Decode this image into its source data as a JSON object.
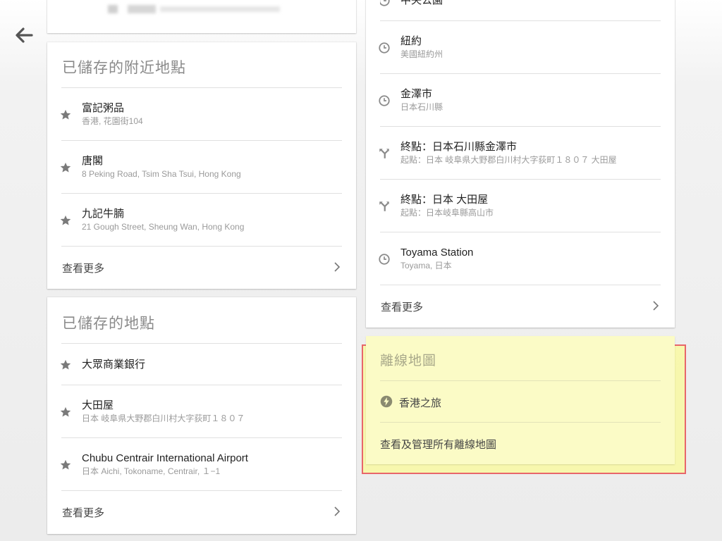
{
  "nav": {
    "back_icon": "arrow-left-icon"
  },
  "colors": {
    "highlight_border": "#e8666a",
    "highlight_fill": "#ffff78"
  },
  "left": {
    "nearby_card": {
      "title": "已儲存的附近地點",
      "items": [
        {
          "icon": "star-icon",
          "name": "富記粥品",
          "detail": "香港, 花園街104"
        },
        {
          "icon": "star-icon",
          "name": "唐閣",
          "detail": "8 Peking Road, Tsim Sha Tsui, Hong Kong"
        },
        {
          "icon": "star-icon",
          "name": "九記牛腩",
          "detail": "21 Gough Street, Sheung Wan, Hong Kong"
        }
      ],
      "more_label": "查看更多"
    },
    "saved_card": {
      "title": "已儲存的地點",
      "items": [
        {
          "icon": "star-icon",
          "name": "大眾商業銀行",
          "detail": ""
        },
        {
          "icon": "star-icon",
          "name": "大田屋",
          "detail": "日本 岐阜県大野郡白川村大字荻町１８０７"
        },
        {
          "icon": "star-icon",
          "name": "Chubu Centrair International Airport",
          "detail": "日本 Aichi, Tokoname, Centrair, １−1"
        }
      ],
      "more_label": "查看更多"
    }
  },
  "right": {
    "history_card": {
      "partial_item": "中央公園",
      "items": [
        {
          "icon": "clock-icon",
          "name": "紐約",
          "detail": "美國紐約州"
        },
        {
          "icon": "clock-icon",
          "name": "金澤市",
          "detail": "日本石川縣"
        },
        {
          "icon": "directions-icon",
          "name": "終點：日本石川縣金澤市",
          "detail": "起點：日本 岐阜県大野郡白川村大字荻町１８０７ 大田屋"
        },
        {
          "icon": "directions-icon",
          "name": "終點：日本 大田屋",
          "detail": "起點：日本岐阜縣高山市"
        },
        {
          "icon": "clock-icon",
          "name": "Toyama Station",
          "detail": "Toyama, 日本"
        }
      ],
      "more_label": "查看更多"
    },
    "offline_card": {
      "title": "離線地圖",
      "items": [
        {
          "icon": "bolt-icon",
          "name": "香港之旅"
        }
      ],
      "manage_label": "查看及管理所有離線地圖"
    }
  }
}
